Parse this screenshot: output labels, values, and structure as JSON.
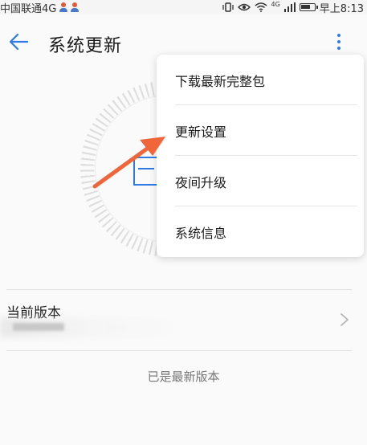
{
  "status_bar": {
    "carrier": "中国联通4G",
    "network_label": "4G",
    "time": "早上8:13"
  },
  "header": {
    "title": "系统更新"
  },
  "menu": {
    "items": [
      {
        "label": "下载最新完整包"
      },
      {
        "label": "更新设置"
      },
      {
        "label": "夜间升级"
      },
      {
        "label": "系统信息"
      }
    ]
  },
  "version": {
    "label": "当前版本",
    "status": "已是最新版本"
  },
  "colors": {
    "accent": "#2f7be5",
    "annotation_arrow": "#f0663a"
  },
  "icons": [
    "back-arrow-icon",
    "more-vert-icon",
    "chevron-right-icon",
    "battery-icon",
    "wifi-icon",
    "signal-icon",
    "eye-icon",
    "vibrate-icon"
  ]
}
